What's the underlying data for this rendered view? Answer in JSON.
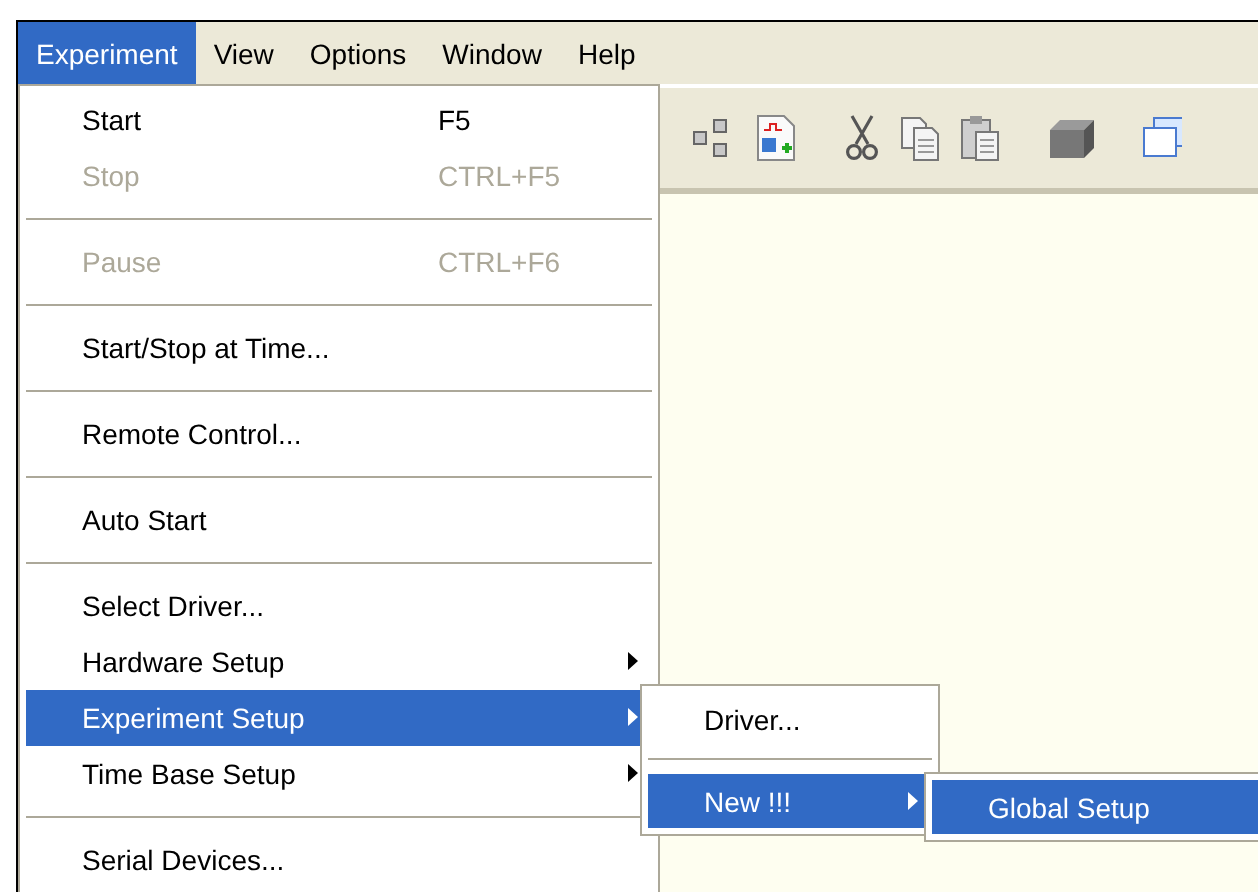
{
  "menubar": [
    {
      "label": "Experiment",
      "selected": true
    },
    {
      "label": "View",
      "selected": false
    },
    {
      "label": "Options",
      "selected": false
    },
    {
      "label": "Window",
      "selected": false
    },
    {
      "label": "Help",
      "selected": false
    }
  ],
  "menu": [
    {
      "kind": "item",
      "label": "Start",
      "shortcut": "F5",
      "disabled": false,
      "submenu": false,
      "selected": false
    },
    {
      "kind": "item",
      "label": "Stop",
      "shortcut": "CTRL+F5",
      "disabled": true,
      "submenu": false,
      "selected": false
    },
    {
      "kind": "separator"
    },
    {
      "kind": "item",
      "label": "Pause",
      "shortcut": "CTRL+F6",
      "disabled": true,
      "submenu": false,
      "selected": false
    },
    {
      "kind": "separator"
    },
    {
      "kind": "item",
      "label": "Start/Stop at Time...",
      "disabled": false,
      "submenu": false,
      "selected": false
    },
    {
      "kind": "separator"
    },
    {
      "kind": "item",
      "label": "Remote Control...",
      "disabled": false,
      "submenu": false,
      "selected": false
    },
    {
      "kind": "separator"
    },
    {
      "kind": "item",
      "label": "Auto Start",
      "disabled": false,
      "submenu": false,
      "selected": false
    },
    {
      "kind": "separator"
    },
    {
      "kind": "item",
      "label": "Select Driver...",
      "disabled": false,
      "submenu": false,
      "selected": false
    },
    {
      "kind": "item",
      "label": "Hardware Setup",
      "disabled": false,
      "submenu": true,
      "selected": false
    },
    {
      "kind": "item",
      "label": "Experiment Setup",
      "disabled": false,
      "submenu": true,
      "selected": true
    },
    {
      "kind": "item",
      "label": "Time Base Setup",
      "disabled": false,
      "submenu": true,
      "selected": false
    },
    {
      "kind": "separator"
    },
    {
      "kind": "item",
      "label": "Serial Devices...",
      "disabled": false,
      "submenu": false,
      "selected": false
    }
  ],
  "submenu": [
    {
      "kind": "item",
      "label": "Driver...",
      "disabled": false,
      "submenu": false,
      "selected": false
    },
    {
      "kind": "separator"
    },
    {
      "kind": "item",
      "label": "New !!!",
      "disabled": false,
      "submenu": true,
      "selected": true
    }
  ],
  "submenu_2": [
    {
      "kind": "item",
      "label": "Global Setup",
      "disabled": false,
      "selected": true
    }
  ]
}
